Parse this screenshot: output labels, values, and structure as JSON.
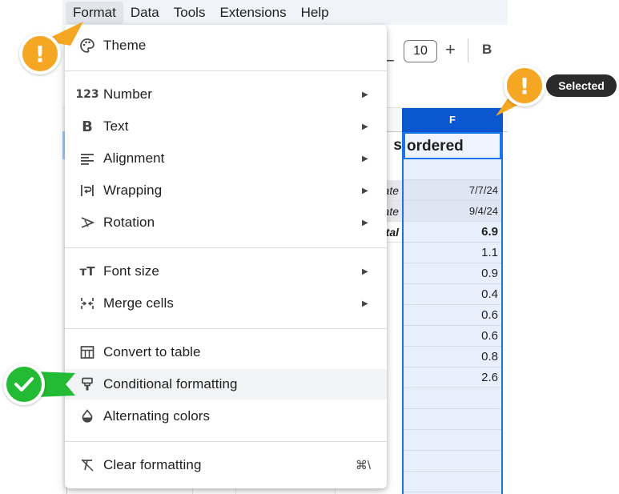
{
  "menubar": {
    "items": [
      {
        "label": "Format"
      },
      {
        "label": "Data"
      },
      {
        "label": "Tools"
      },
      {
        "label": "Extensions"
      },
      {
        "label": "Help"
      }
    ]
  },
  "toolbar": {
    "minus_label": "−",
    "font_size": "10",
    "plus_label": "+",
    "bold_label": "B"
  },
  "sheet": {
    "selected_column": "F",
    "title_left": "s",
    "title_cell": "ordered",
    "left_cells": [
      "ate",
      "ate",
      "tal"
    ],
    "f_dates": [
      "7/7/24",
      "9/4/24"
    ],
    "f_total": "6.9",
    "f_values": [
      "1.1",
      "0.9",
      "0.4",
      "0.6",
      "0.6",
      "0.8",
      "2.6"
    ]
  },
  "menu": {
    "theme": {
      "label": "Theme",
      "icon": "palette-icon"
    },
    "number": {
      "label": "Number",
      "icon": "123-icon"
    },
    "text": {
      "label": "Text",
      "icon": "bold-b-icon"
    },
    "alignment": {
      "label": "Alignment",
      "icon": "align-left-icon"
    },
    "wrapping": {
      "label": "Wrapping",
      "icon": "wrap-icon"
    },
    "rotation": {
      "label": "Rotation",
      "icon": "rotate-text-icon"
    },
    "font_size": {
      "label": "Font size",
      "icon": "font-size-icon"
    },
    "merge_cells": {
      "label": "Merge cells",
      "icon": "merge-icon"
    },
    "convert_to_table": {
      "label": "Convert to table",
      "icon": "table-icon"
    },
    "conditional_formatting": {
      "label": "Conditional formatting",
      "icon": "paint-roller-icon"
    },
    "alternating_colors": {
      "label": "Alternating colors",
      "icon": "drop-icon"
    },
    "clear_formatting": {
      "label": "Clear formatting",
      "icon": "clear-format-icon",
      "shortcut": "⌘\\"
    }
  },
  "callouts": {
    "selected_badge": "Selected",
    "colors": {
      "warning": "#f5a623",
      "success": "#22bb33",
      "selection": "#0b57d0"
    }
  }
}
